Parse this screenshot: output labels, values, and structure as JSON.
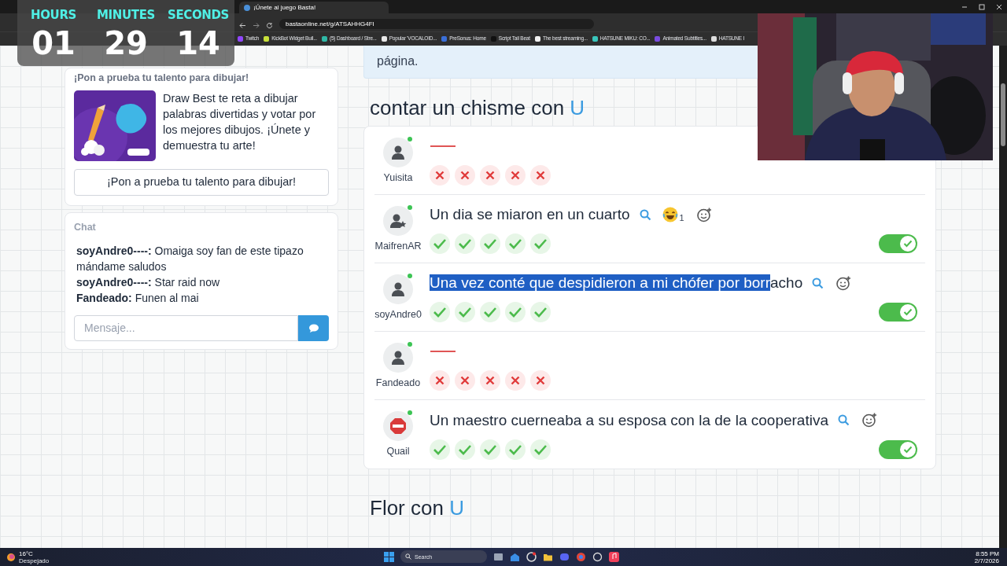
{
  "browser": {
    "tab_title": "¡Únete al juego Basta!",
    "url": "bastaonline.net/g/ATSAHHG4FI",
    "bookmarks": [
      {
        "label": "Twitch",
        "color": "#9146ff"
      },
      {
        "label": "KickBot Widget Buil...",
        "color": "#c8e03a"
      },
      {
        "label": "(5) Dashboard / Stre...",
        "color": "#2fb8a6"
      },
      {
        "label": "Popular 'VOCALOID...",
        "color": "#e8e8e8"
      },
      {
        "label": "PreSonus: Home",
        "color": "#3a6fd8"
      },
      {
        "label": "Script Tail Beat",
        "color": "#111111"
      },
      {
        "label": "The best streaming...",
        "color": "#f2f2f2"
      },
      {
        "label": "HATSUNE MIKU: CO...",
        "color": "#39c5bb"
      },
      {
        "label": "Animated Subtitles...",
        "color": "#7a4ce0"
      },
      {
        "label": "HATSUNE I",
        "color": "#dddddd"
      }
    ]
  },
  "timer": [
    {
      "label": "HOURS",
      "value": "01"
    },
    {
      "label": "MINUTES",
      "value": "29"
    },
    {
      "label": "SECONDS",
      "value": "14"
    }
  ],
  "sidebar": {
    "promo": {
      "heading": "¡Pon a prueba tu talento para dibujar!",
      "description": "Draw Best te reta a dibujar palabras divertidas y votar por los mejores dibujos. ¡Únete y demuestra tu arte!",
      "button": "¡Pon a prueba tu talento para dibujar!"
    },
    "chat": {
      "title": "Chat",
      "messages": [
        {
          "user": "soyAndre0----:",
          "text": "Omaiga soy fan de este tipazo mándame saludos"
        },
        {
          "user": "soyAndre0----:",
          "text": "Star raid now"
        },
        {
          "user": "Fandeado:",
          "text": "Funen al mai"
        }
      ],
      "placeholder": "Mensaje..."
    }
  },
  "notice": {
    "text": "página."
  },
  "categories": [
    {
      "title": "contar un chisme con",
      "letter": "U",
      "answers": [
        {
          "user": "Yuisita",
          "kind": "person",
          "online": true,
          "votes": [
            false,
            false,
            false,
            false,
            false
          ]
        },
        {
          "user": "MaifrenAR",
          "kind": "person_star",
          "online": true,
          "text": "Un dia se miaron en un cuarto",
          "reaction_count": "1",
          "valid": true,
          "votes": [
            true,
            true,
            true,
            true,
            true
          ]
        },
        {
          "user": "soyAndre0",
          "kind": "person",
          "online": true,
          "selected_part": "Una vez conté que despidieron a mi chófer por borr",
          "text": "acho",
          "valid": true,
          "votes": [
            true,
            true,
            true,
            true,
            true
          ]
        },
        {
          "user": "Fandeado",
          "kind": "person",
          "online": true,
          "votes": [
            false,
            false,
            false,
            false,
            false
          ]
        },
        {
          "user": "Quail",
          "kind": "stop",
          "online": true,
          "text": "Un maestro cuerneaba a su esposa con la de la cooperativa",
          "valid": true,
          "votes": [
            true,
            true,
            true,
            true,
            true
          ]
        }
      ]
    },
    {
      "title": "Flor con",
      "letter": "U"
    }
  ],
  "taskbar": {
    "temperature": "16°C",
    "weather": "Despejado",
    "search": "Search",
    "time": "8:55 PM",
    "date": "2/7/2026"
  }
}
